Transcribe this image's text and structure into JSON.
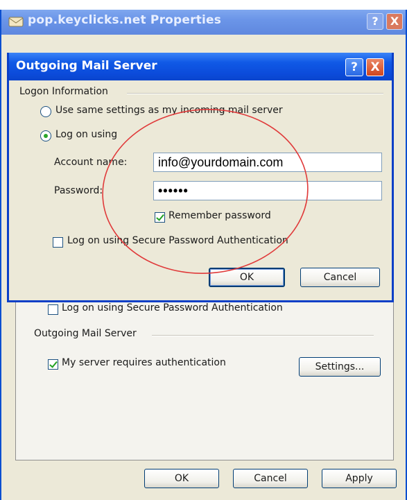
{
  "back_window": {
    "title": "pop.keyclicks.net Properties",
    "help_label": "?",
    "close_label": "X",
    "spa_checkbox_label": "Log on using Secure Password Authentication",
    "outgoing_group_label": "Outgoing Mail Server",
    "requires_auth_label": "My server requires authentication",
    "requires_auth_checked": true,
    "settings_button_label": "Settings...",
    "ok_label": "OK",
    "cancel_label": "Cancel",
    "apply_label": "Apply"
  },
  "dialog": {
    "title": "Outgoing Mail Server",
    "help_label": "?",
    "close_label": "X",
    "logon_group_label": "Logon Information",
    "radio_same_label": "Use same settings as my incoming mail server",
    "radio_logon_label": "Log on using",
    "selected_radio": "logon",
    "account_name_label": "Account name:",
    "account_name_value": "info@yourdomain.com",
    "password_label": "Password:",
    "password_value": "••••••",
    "remember_password_label": "Remember password",
    "remember_password_checked": true,
    "spa_label": "Log on using Secure Password Authentication",
    "spa_checked": false,
    "ok_label": "OK",
    "cancel_label": "Cancel"
  },
  "colors": {
    "annotation": "#e03a3a",
    "titlebar_active": "#0b4ad9",
    "titlebar_inactive": "#6b95e8",
    "window_face": "#ece9d8"
  }
}
